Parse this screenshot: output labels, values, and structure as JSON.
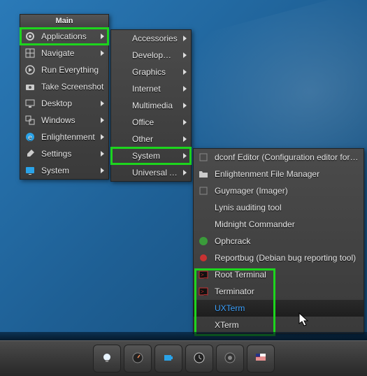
{
  "menu1": {
    "title": "Main",
    "items": [
      {
        "label": "Applications",
        "icon": "gear",
        "arrow": true,
        "hl": true
      },
      {
        "label": "Navigate",
        "icon": "nav",
        "arrow": true
      },
      {
        "label": "Run Everything",
        "icon": "run"
      },
      {
        "label": "Take Screenshot",
        "icon": "camera"
      },
      {
        "label": "Desktop",
        "icon": "desktop",
        "arrow": true
      },
      {
        "label": "Windows",
        "icon": "windows",
        "arrow": true
      },
      {
        "label": "Enlightenment",
        "icon": "e",
        "arrow": true
      },
      {
        "label": "Settings",
        "icon": "wrench",
        "arrow": true
      },
      {
        "label": "System",
        "icon": "monitor",
        "arrow": true
      }
    ]
  },
  "menu2": {
    "items": [
      {
        "label": "Accessories",
        "arrow": true
      },
      {
        "label": "Development",
        "arrow": true
      },
      {
        "label": "Graphics",
        "arrow": true
      },
      {
        "label": "Internet",
        "arrow": true
      },
      {
        "label": "Multimedia",
        "arrow": true
      },
      {
        "label": "Office",
        "arrow": true
      },
      {
        "label": "Other",
        "arrow": true
      },
      {
        "label": "System",
        "arrow": true,
        "hl": true
      },
      {
        "label": "Universal Access",
        "arrow": true
      }
    ]
  },
  "menu3": {
    "items": [
      {
        "label": "dconf Editor (Configuration editor for dconf)",
        "icon": "blank"
      },
      {
        "label": "Enlightenment File Manager",
        "icon": "folder"
      },
      {
        "label": "Guymager (Imager)",
        "icon": "blank"
      },
      {
        "label": "Lynis auditing tool",
        "icon": "none"
      },
      {
        "label": "Midnight Commander",
        "icon": "none"
      },
      {
        "label": "Ophcrack",
        "icon": "oph"
      },
      {
        "label": "Reportbug (Debian bug reporting tool)",
        "icon": "bug"
      },
      {
        "label": "Root Terminal",
        "icon": "term-red"
      },
      {
        "label": "Terminator",
        "icon": "term-red"
      },
      {
        "label": "UXTerm",
        "icon": "none",
        "hovered": true
      },
      {
        "label": "XTerm",
        "icon": "none"
      }
    ]
  },
  "taskbar": {
    "items": [
      "bulb",
      "gauge",
      "battery",
      "clock",
      "cpu",
      "flag"
    ]
  }
}
